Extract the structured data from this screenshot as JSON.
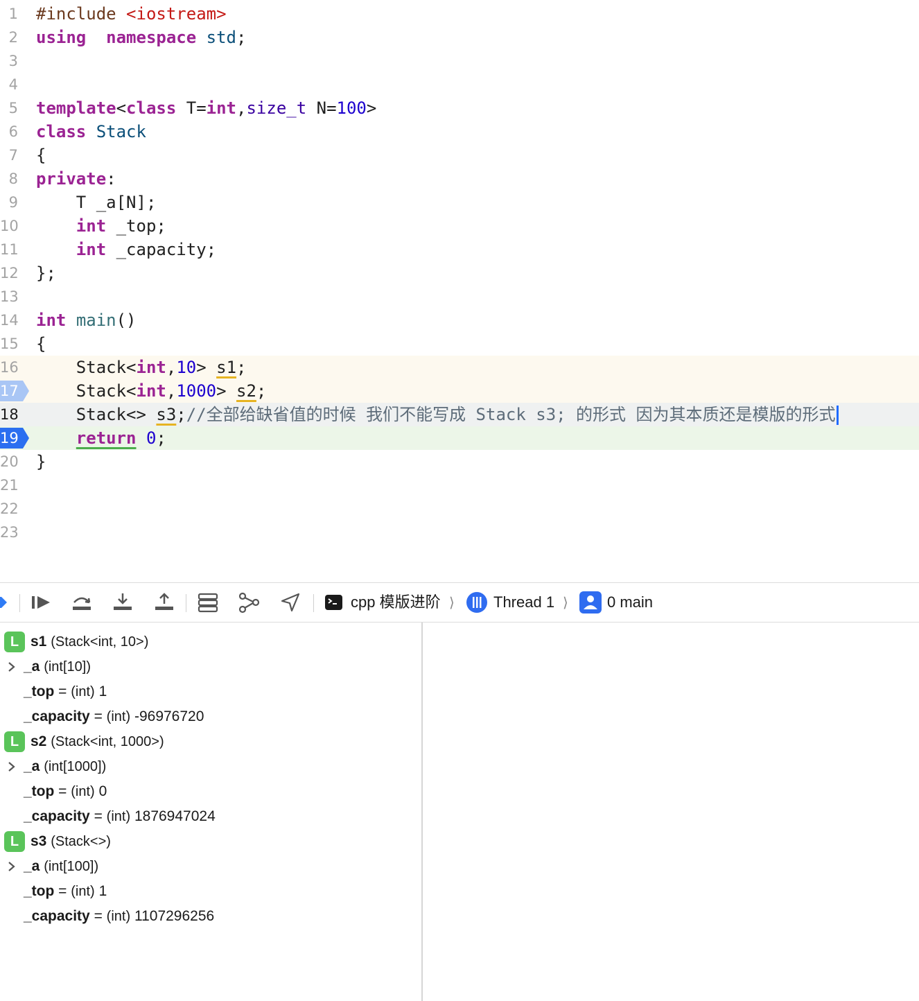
{
  "editor": {
    "lines": [
      {
        "n": "1",
        "parts": [
          [
            "pp",
            "#include "
          ],
          [
            "str",
            "<iostream>"
          ]
        ]
      },
      {
        "n": "2",
        "parts": [
          [
            "kw",
            "using"
          ],
          [
            "",
            "  "
          ],
          [
            "kw",
            "namespace"
          ],
          [
            "",
            " "
          ],
          [
            "cls",
            "std"
          ],
          [
            "",
            ";"
          ]
        ]
      },
      {
        "n": "3",
        "parts": []
      },
      {
        "n": "4",
        "parts": []
      },
      {
        "n": "5",
        "parts": [
          [
            "kw",
            "template"
          ],
          [
            "",
            "<"
          ],
          [
            "kw",
            "class"
          ],
          [
            "",
            " T="
          ],
          [
            "kw",
            "int"
          ],
          [
            "",
            ","
          ],
          [
            "type",
            "size_t"
          ],
          [
            "",
            " N="
          ],
          [
            "num",
            "100"
          ],
          [
            "",
            ">"
          ]
        ]
      },
      {
        "n": "6",
        "parts": [
          [
            "kw",
            "class"
          ],
          [
            "",
            " "
          ],
          [
            "cls",
            "Stack"
          ]
        ]
      },
      {
        "n": "7",
        "parts": [
          [
            "",
            "{"
          ]
        ]
      },
      {
        "n": "8",
        "parts": [
          [
            "kw",
            "private"
          ],
          [
            "",
            ":"
          ]
        ]
      },
      {
        "n": "9",
        "parts": [
          [
            "",
            "    T _a[N];"
          ]
        ]
      },
      {
        "n": "10",
        "parts": [
          [
            "",
            "    "
          ],
          [
            "kw",
            "int"
          ],
          [
            "",
            " _top;"
          ]
        ]
      },
      {
        "n": "11",
        "parts": [
          [
            "",
            "    "
          ],
          [
            "kw",
            "int"
          ],
          [
            "",
            " _capacity;"
          ]
        ]
      },
      {
        "n": "12",
        "parts": [
          [
            "",
            "};"
          ]
        ]
      },
      {
        "n": "13",
        "parts": []
      },
      {
        "n": "14",
        "parts": [
          [
            "kw",
            "int"
          ],
          [
            "",
            " "
          ],
          [
            "fn",
            "main"
          ],
          [
            "",
            "()"
          ]
        ]
      },
      {
        "n": "15",
        "parts": [
          [
            "",
            "{"
          ]
        ]
      },
      {
        "n": "16",
        "parts": [
          [
            "",
            "    Stack<"
          ],
          [
            "kw",
            "int"
          ],
          [
            "",
            ","
          ],
          [
            "num",
            "10"
          ],
          [
            "",
            "> "
          ],
          [
            "warn",
            "s1"
          ],
          [
            "",
            ";"
          ]
        ]
      },
      {
        "n": "17",
        "parts": [
          [
            "",
            "    Stack<"
          ],
          [
            "kw",
            "int"
          ],
          [
            "",
            ","
          ],
          [
            "num",
            "1000"
          ],
          [
            "",
            "> "
          ],
          [
            "warn",
            "s2"
          ],
          [
            "",
            ";"
          ]
        ]
      },
      {
        "n": "18",
        "parts": [
          [
            "",
            "    Stack<> "
          ],
          [
            "warn",
            "s3"
          ],
          [
            "",
            ";"
          ],
          [
            "cmt",
            "//全部给缺省值的时候 我们不能写成 Stack s3; 的形式 因为其本质还是模版的形式"
          ]
        ]
      },
      {
        "n": "19",
        "parts": [
          [
            "",
            "    "
          ],
          [
            "ret",
            "return"
          ],
          [
            "",
            " "
          ],
          [
            "num",
            "0"
          ],
          [
            "",
            ";"
          ]
        ]
      },
      {
        "n": "20",
        "parts": [
          [
            "",
            "}"
          ]
        ]
      },
      {
        "n": "21",
        "parts": []
      },
      {
        "n": "22",
        "parts": []
      },
      {
        "n": "23",
        "parts": []
      }
    ]
  },
  "debugbar": {
    "target": "cpp 模版进阶",
    "thread": "Thread 1",
    "frame": "0 main"
  },
  "variables": [
    {
      "kind": "local",
      "badge": "L",
      "name": "s1",
      "type": "(Stack<int, 10>)"
    },
    {
      "kind": "child",
      "expand": true,
      "name": "_a",
      "type": "(int[10])",
      "value": ""
    },
    {
      "kind": "child",
      "expand": false,
      "name": "_top",
      "eq": " = ",
      "type": "(int)",
      "value": "1"
    },
    {
      "kind": "child",
      "expand": false,
      "name": "_capacity",
      "eq": " = ",
      "type": "(int)",
      "value": "-96976720"
    },
    {
      "kind": "local",
      "badge": "L",
      "name": "s2",
      "type": "(Stack<int, 1000>)"
    },
    {
      "kind": "child",
      "expand": true,
      "name": "_a",
      "type": "(int[1000])",
      "value": ""
    },
    {
      "kind": "child",
      "expand": false,
      "name": "_top",
      "eq": " = ",
      "type": "(int)",
      "value": "0"
    },
    {
      "kind": "child",
      "expand": false,
      "name": "_capacity",
      "eq": " = ",
      "type": "(int)",
      "value": "1876947024"
    },
    {
      "kind": "local",
      "badge": "L",
      "name": "s3",
      "type": "(Stack<>)"
    },
    {
      "kind": "child",
      "expand": true,
      "name": "_a",
      "type": "(int[100])",
      "value": ""
    },
    {
      "kind": "child",
      "expand": false,
      "name": "_top",
      "eq": " = ",
      "type": "(int)",
      "value": "1"
    },
    {
      "kind": "child",
      "expand": false,
      "name": "_capacity",
      "eq": " = ",
      "type": "(int)",
      "value": "1107296256"
    }
  ]
}
